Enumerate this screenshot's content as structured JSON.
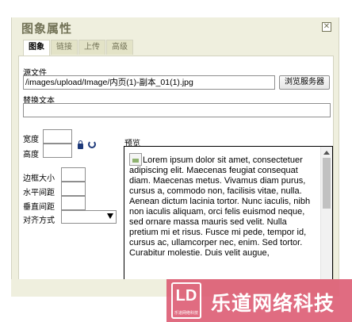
{
  "dialog": {
    "title": "图象属性",
    "close_symbol": "✕"
  },
  "tabs": [
    {
      "label": "图象",
      "active": true
    },
    {
      "label": "链接",
      "active": false
    },
    {
      "label": "上传",
      "active": false
    },
    {
      "label": "高级",
      "active": false
    }
  ],
  "form": {
    "source_label": "源文件",
    "source_value": "/images/upload/Image/内页(1)-副本_01(1).jpg",
    "browse_label": "浏览服务器",
    "alt_label": "替换文本",
    "alt_value": "",
    "width_label": "宽度",
    "height_label": "高度",
    "width_value": "",
    "height_value": "",
    "border_label": "边框大小",
    "hspace_label": "水平间距",
    "vspace_label": "垂直间距",
    "align_label": "对齐方式",
    "align_value": "",
    "preview_label": "预览"
  },
  "preview": {
    "text": "Lorem ipsum dolor sit amet, consectetuer adipiscing elit. Maecenas feugiat consequat diam. Maecenas metus. Vivamus diam purus, cursus a, commodo non, facilisis vitae, nulla. Aenean dictum lacinia tortor. Nunc iaculis, nibh non iaculis aliquam, orci felis euismod neque, sed ornare massa mauris sed velit. Nulla pretium mi et risus. Fusce mi pede, tempor id, cursus ac, ullamcorper nec, enim. Sed tortor. Curabitur molestie. Duis velit augue,"
  },
  "watermark": {
    "logo": "LD",
    "logo_sub": "乐道网络科技",
    "text": "乐道网络科技"
  }
}
